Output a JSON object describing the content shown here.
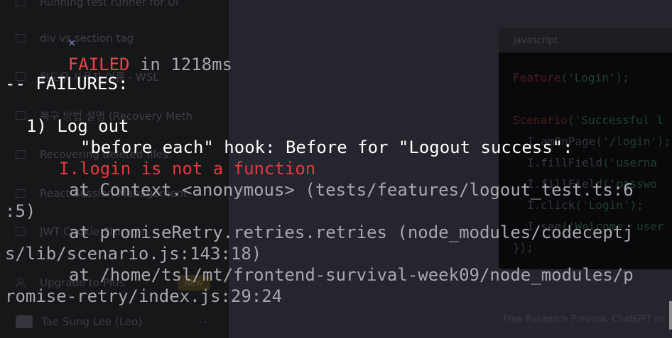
{
  "background_app": {
    "sidebar": {
      "items": [
        {
          "label": "Running test runner for UI"
        },
        {
          "label": "div vs section tag"
        },
        {
          "label": "윈도우 사용자 이름 - WSL"
        },
        {
          "label": "복구 방법 설명 (Recovery Meth"
        },
        {
          "label": "Recovering deleted files."
        },
        {
          "label": "React Session Management"
        },
        {
          "label": "JWT Cookie Storage"
        }
      ],
      "upgrade_label": "Upgrade to Plus",
      "new_badge": "NEW",
      "user_name": "Tae Sung Lee (Leo)",
      "menu_dots": "···"
    },
    "code_block": {
      "language": "javascript",
      "lines": [
        {
          "fn": "Feature",
          "args": "('Login');"
        },
        {
          "fn": "Scenario",
          "args": "('Successful l"
        },
        {
          "fn": "I.amOnPage",
          "args": "('/login');"
        },
        {
          "fn": "I.fillField",
          "args": "('userna"
        },
        {
          "fn": "I.fillField",
          "args": "('passwo"
        },
        {
          "fn": "I.click",
          "args": "('Login');"
        },
        {
          "fn": "I.see",
          "args": "('Welcome, user"
        },
        {
          "fn": "",
          "args": "});"
        }
      ]
    },
    "footer_note": "Free Research Preview. ChatGPT m"
  },
  "terminal": {
    "status_icon": "×",
    "status_word": "FAILED",
    "status_rest": " in 1218ms",
    "failures_header": "-- FAILURES:",
    "failure_title": "1) Log out",
    "hook_line": "\"before each\" hook: Before for \"Logout success\":",
    "error_message": "I.login is not a function",
    "stack": [
      "at Context.<anonymous> (tests/features/logout_test.ts:6",
      ":5)",
      "at promiseRetry.retries.retries (node_modules/codeceptj",
      "s/lib/scenario.js:143:18)",
      "at /home/tsl/mt/frontend-survival-week09/node_modules/p",
      "romise-retry/index.js:29:24"
    ]
  },
  "colors": {
    "accent_red": "#e0241f",
    "failed_red": "#e8474a",
    "error_red": "#e23b3f",
    "stack_gray": "#a7a7ad",
    "icon_purple": "#7b7fb5"
  }
}
